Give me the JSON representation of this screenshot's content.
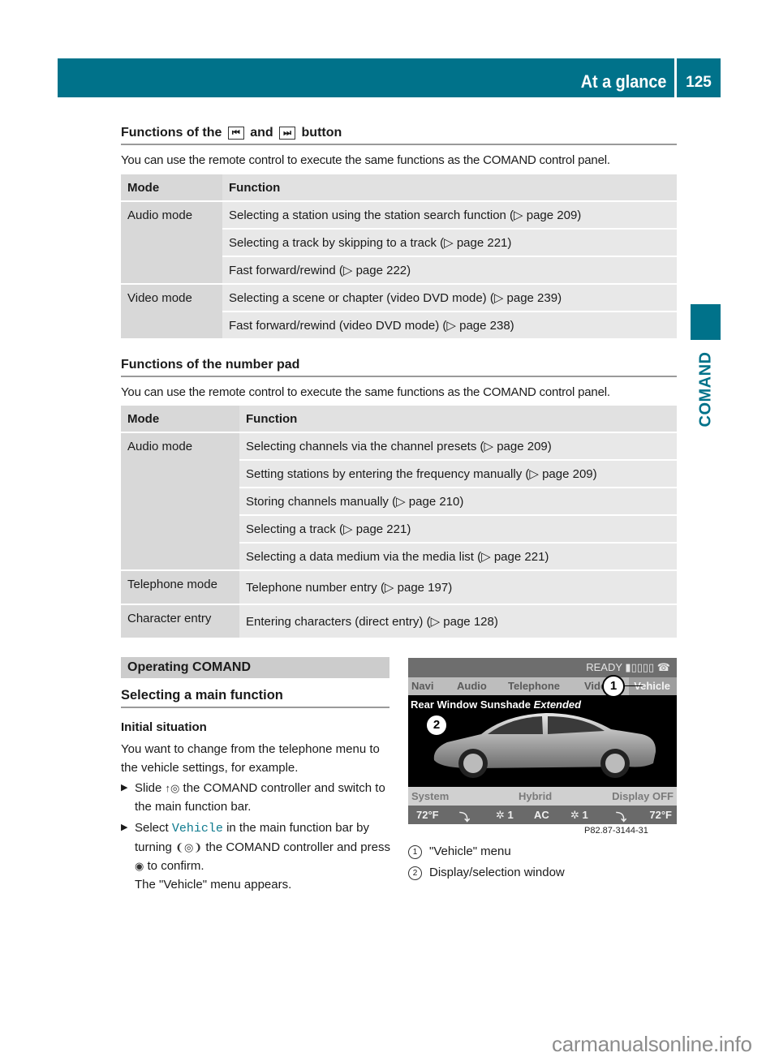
{
  "header": {
    "section_title": "At a glance",
    "page_number": "125"
  },
  "side_tab": {
    "label": "COMAND"
  },
  "section1": {
    "heading_pre": "Functions of the",
    "button1_glyph": "⏮",
    "heading_mid": "and",
    "button2_glyph": "⏭",
    "heading_post": "button",
    "intro": "You can use the remote control to execute the same functions as the COMAND control panel.",
    "table": {
      "headers": [
        "Mode",
        "Function"
      ],
      "groups": [
        {
          "mode": "Audio mode",
          "functions": [
            "Selecting a station using the station search function (▷ page 209)",
            "Selecting a track by skipping to a track (▷ page 221)",
            "Fast forward/rewind (▷ page 222)"
          ]
        },
        {
          "mode": "Video mode",
          "functions": [
            "Selecting a scene or chapter (video DVD mode) (▷ page 239)",
            "Fast forward/rewind (video DVD mode) (▷ page 238)"
          ]
        }
      ]
    }
  },
  "section2": {
    "heading": "Functions of the number pad",
    "intro": "You can use the remote control to execute the same functions as the COMAND control panel.",
    "table": {
      "headers": [
        "Mode",
        "Function"
      ],
      "groups": [
        {
          "mode": "Audio mode",
          "functions": [
            "Selecting channels via the channel presets (▷ page 209)",
            "Setting stations by entering the frequency manually (▷ page 209)",
            "Storing channels manually (▷ page 210)",
            "Selecting a track (▷ page 221)",
            "Selecting a data medium via the media list (▷ page 221)"
          ]
        },
        {
          "mode": "Telephone mode",
          "functions": [
            "Telephone number entry (▷ page 197)"
          ]
        },
        {
          "mode": "Character entry",
          "functions": [
            "Entering characters (direct entry) (▷ page 128)"
          ]
        }
      ]
    }
  },
  "operating": {
    "box_heading": "Operating COMAND",
    "sub_heading": "Selecting a main function",
    "label": "Initial situation",
    "paragraph": "You want to change from the telephone menu to the vehicle settings, for example.",
    "step1": {
      "pre": "Slide",
      "ctl": "↑◎",
      "post": "the COMAND controller and switch to the main function bar."
    },
    "step2": {
      "pre": "Select",
      "code": "Vehicle",
      "mid": "in the main function bar by turning",
      "ctl": "❨◎❩",
      "mid2": "the COMAND controller and press",
      "ctl2": "◉",
      "post": "to confirm.",
      "result": "The \"Vehicle\" menu appears."
    }
  },
  "screen": {
    "status": "READY ▮▯▯▯▯ ☎",
    "nav": [
      "Navi",
      "Audio",
      "Telephone",
      "Vide",
      "Vehicle"
    ],
    "caption_normal": "Rear Window Sunshade",
    "caption_italic": "Extended",
    "bar1": [
      "System",
      "Hybrid",
      "Display OFF"
    ],
    "bar2": [
      "72°F",
      "⤵",
      "✲ 1",
      "AC",
      "✲ 1",
      "⤵",
      "72°F"
    ],
    "callout1": "1",
    "callout2": "2",
    "figure_ref": "P82.87-3144-31"
  },
  "legend": [
    {
      "num": "1",
      "text": "\"Vehicle\" menu"
    },
    {
      "num": "2",
      "text": "Display/selection window"
    }
  ],
  "watermark": "carmanualsonline.info"
}
